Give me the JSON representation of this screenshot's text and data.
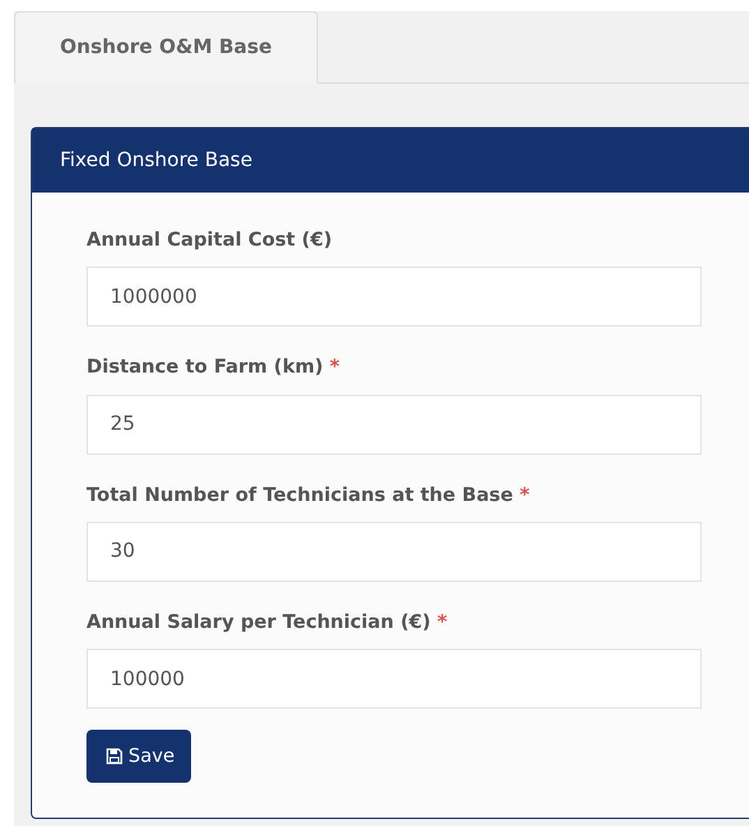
{
  "tabs": [
    {
      "label": "Onshore O&M Base",
      "selected": true
    }
  ],
  "panel": {
    "title": "Fixed Onshore Base",
    "fields": [
      {
        "label": "Annual Capital Cost (€)",
        "value": "1000000"
      },
      {
        "label": "Distance to Farm (km)",
        "required_mark": "*",
        "value": "25"
      },
      {
        "label": "Total Number of Technicians at the Base",
        "required_mark": "*",
        "value": "30"
      },
      {
        "label": "Annual Salary per Technician (€)",
        "required_mark": "*",
        "value": "100000"
      }
    ],
    "save_button": "Save"
  }
}
